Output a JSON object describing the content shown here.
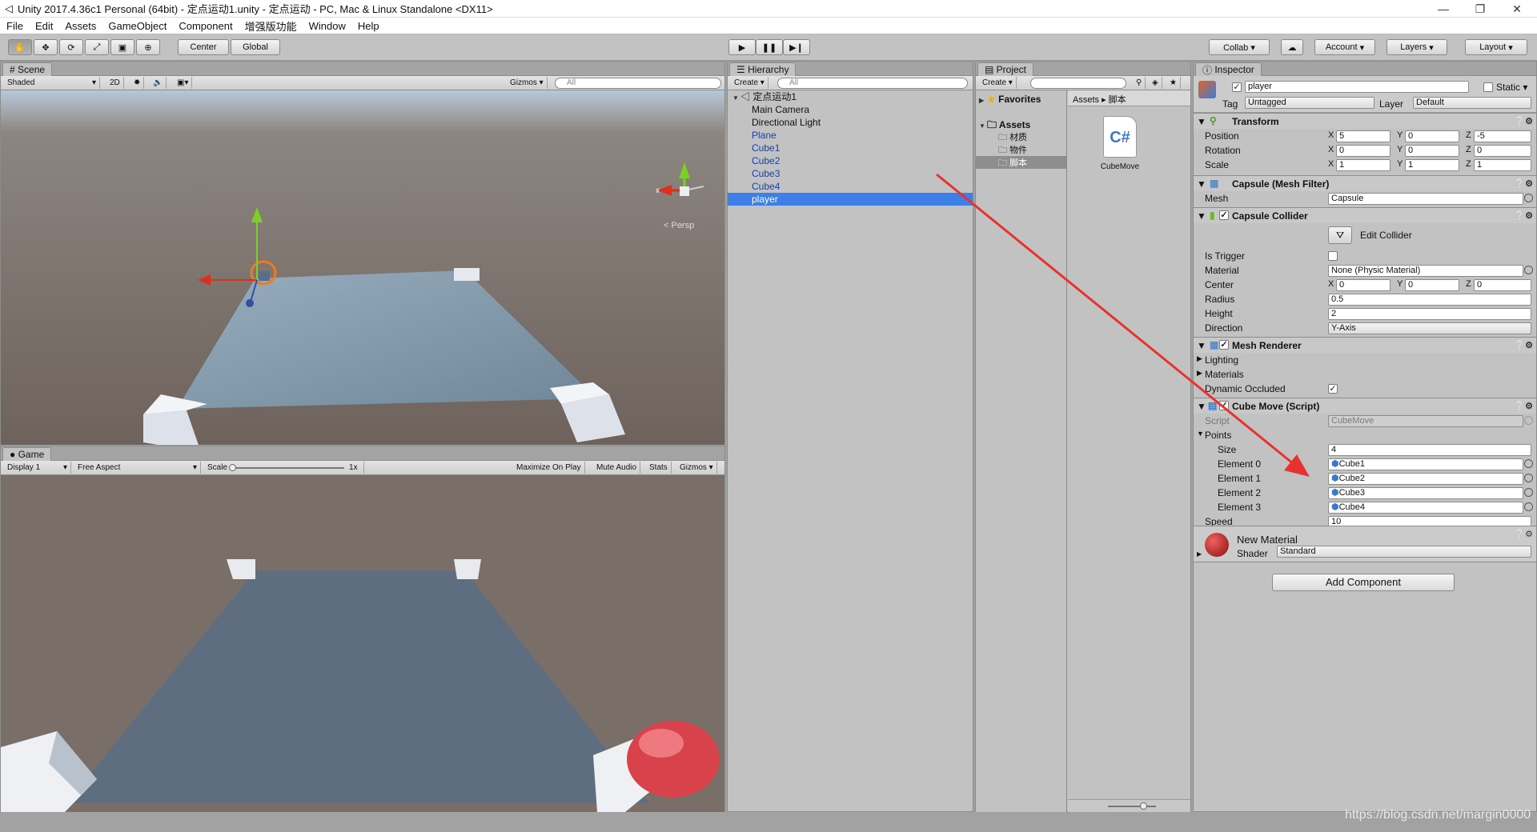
{
  "window": {
    "title": "Unity 2017.4.36c1 Personal (64bit) - 定点运动1.unity - 定点运动 - PC, Mac & Linux Standalone <DX11>",
    "minimize": "—",
    "maximize": "❐",
    "close": "✕"
  },
  "menu": [
    "File",
    "Edit",
    "Assets",
    "GameObject",
    "Component",
    "增强版功能",
    "Window",
    "Help"
  ],
  "toolbar": {
    "pivot": "Center",
    "space": "Global",
    "collab": "Collab ▾",
    "account": "Account",
    "layers": "Layers",
    "layout": "Layout"
  },
  "scene": {
    "tab": "Scene",
    "shading": "Shaded",
    "mode2d": "2D",
    "gizmos": "Gizmos ▾",
    "search_placeholder": "All",
    "persp": "< Persp"
  },
  "game": {
    "tab": "Game",
    "display": "Display 1",
    "aspect": "Free Aspect",
    "scale_label": "Scale",
    "scale_value": "1x",
    "maximize": "Maximize On Play",
    "mute": "Mute Audio",
    "stats": "Stats",
    "gizmos": "Gizmos ▾"
  },
  "hierarchy": {
    "tab": "Hierarchy",
    "create": "Create ▾",
    "search_placeholder": "All",
    "scene_name": "定点运动1",
    "items": [
      {
        "label": "Main Camera"
      },
      {
        "label": "Directional Light"
      },
      {
        "label": "Plane"
      },
      {
        "label": "Cube1"
      },
      {
        "label": "Cube2"
      },
      {
        "label": "Cube3"
      },
      {
        "label": "Cube4"
      },
      {
        "label": "player"
      }
    ]
  },
  "project": {
    "tab": "Project",
    "create": "Create ▾",
    "favorites": "Favorites",
    "assets": "Assets",
    "folders": [
      "材质",
      "物件",
      "脚本"
    ],
    "breadcrumb_root": "Assets",
    "breadcrumb_sep": "▸",
    "breadcrumb_leaf": "脚本",
    "file": "CubeMove",
    "file_glyph": "C#"
  },
  "inspector": {
    "tab": "Inspector",
    "name": "player",
    "static": "Static ▾",
    "tag_label": "Tag",
    "tag": "Untagged",
    "layer_label": "Layer",
    "layer": "Default",
    "transform": {
      "title": "Transform",
      "position": {
        "label": "Position",
        "x": "5",
        "y": "0",
        "z": "-5"
      },
      "rotation": {
        "label": "Rotation",
        "x": "0",
        "y": "0",
        "z": "0"
      },
      "scale": {
        "label": "Scale",
        "x": "1",
        "y": "1",
        "z": "1"
      }
    },
    "mesh_filter": {
      "title": "Capsule (Mesh Filter)",
      "mesh_label": "Mesh",
      "mesh": "Capsule"
    },
    "capsule_collider": {
      "title": "Capsule Collider",
      "edit": "Edit Collider",
      "is_trigger": "Is Trigger",
      "material_label": "Material",
      "material": "None (Physic Material)",
      "center_label": "Center",
      "cx": "0",
      "cy": "0",
      "cz": "0",
      "radius_label": "Radius",
      "radius": "0.5",
      "height_label": "Height",
      "height": "2",
      "direction_label": "Direction",
      "direction": "Y-Axis"
    },
    "mesh_renderer": {
      "title": "Mesh Renderer",
      "lighting": "Lighting",
      "materials": "Materials",
      "dynamic_occluded": "Dynamic Occluded"
    },
    "cube_move": {
      "title": "Cube Move (Script)",
      "script_label": "Script",
      "script": "CubeMove",
      "points": "Points",
      "size_label": "Size",
      "size": "4",
      "elements": [
        {
          "label": "Element 0",
          "value": "Cube1"
        },
        {
          "label": "Element 1",
          "value": "Cube2"
        },
        {
          "label": "Element 2",
          "value": "Cube3"
        },
        {
          "label": "Element 3",
          "value": "Cube4"
        }
      ],
      "speed_label": "Speed",
      "speed": "10"
    },
    "material": {
      "name": "New Material",
      "shader_label": "Shader",
      "shader": "Standard"
    },
    "add_component": "Add Component"
  },
  "watermark": "https://blog.csdn.net/margin0000",
  "colors": {
    "selection": "#3d7fe6",
    "arrow": "#e8322f",
    "ground": "#7a6e68"
  }
}
